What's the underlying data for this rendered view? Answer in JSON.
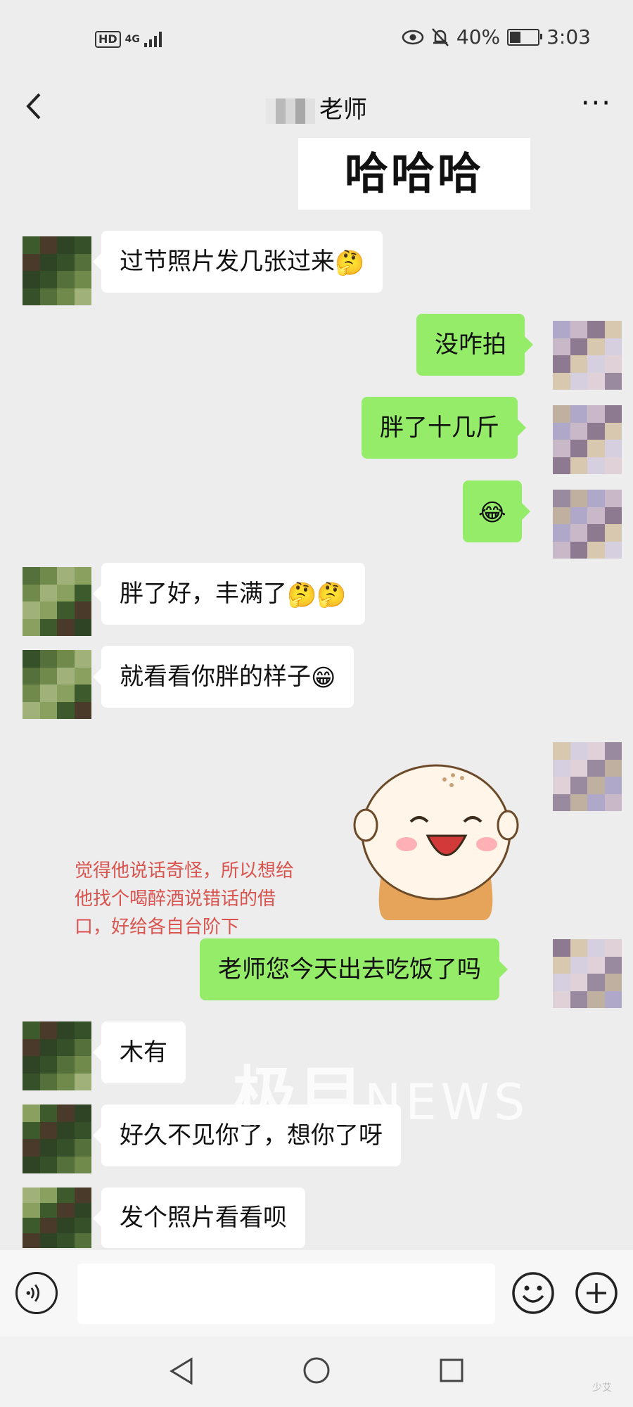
{
  "status_bar": {
    "hd": "HD",
    "network": "4G",
    "battery_percent": "40%",
    "battery_level": 0.4,
    "time": "3:03"
  },
  "header": {
    "title": "老师",
    "back_icon": "chevron-left-icon",
    "more_label": "···"
  },
  "messages": [
    {
      "side": "right",
      "type": "sticker-text",
      "text": "哈哈哈"
    },
    {
      "side": "left",
      "text": "过节照片发几张过来",
      "emoji": "🤔"
    },
    {
      "side": "right",
      "text": "没咋拍"
    },
    {
      "side": "right",
      "text": "胖了十几斤"
    },
    {
      "side": "right",
      "text": "",
      "emoji": "😂"
    },
    {
      "side": "left",
      "text": "胖了好，丰满了",
      "emoji": "🤔🤔"
    },
    {
      "side": "left",
      "text": "就看看你胖的样子",
      "emoji": "😁"
    },
    {
      "side": "right",
      "type": "sticker",
      "sticker": "laughing-monk-sticker"
    },
    {
      "side": "right",
      "text": "老师您今天出去吃饭了吗"
    },
    {
      "side": "left",
      "text": "木有"
    },
    {
      "side": "left",
      "text": "好久不见你了，想你了呀"
    },
    {
      "side": "left",
      "text": "发个照片看看呗"
    }
  ],
  "annotation": {
    "line1": "觉得他说话奇怪，所以想给",
    "line2": "他找个喝醉酒说错话的借",
    "line3": "口，好给各自台阶下"
  },
  "watermark": {
    "brand": "极目",
    "news": "NEWS"
  },
  "input_bar": {
    "placeholder": "",
    "voice_icon": "voice-icon",
    "emoji_icon": "emoji-icon",
    "plus_icon": "plus-icon"
  },
  "nav_bar": {
    "back_icon": "nav-back-icon",
    "home_icon": "nav-home-icon",
    "recent_icon": "nav-recent-icon",
    "corner_mark": "少艾"
  },
  "colors": {
    "background": "#ededed",
    "sent_bubble": "#95ec69",
    "received_bubble": "#ffffff",
    "annotation": "#d9534f"
  }
}
